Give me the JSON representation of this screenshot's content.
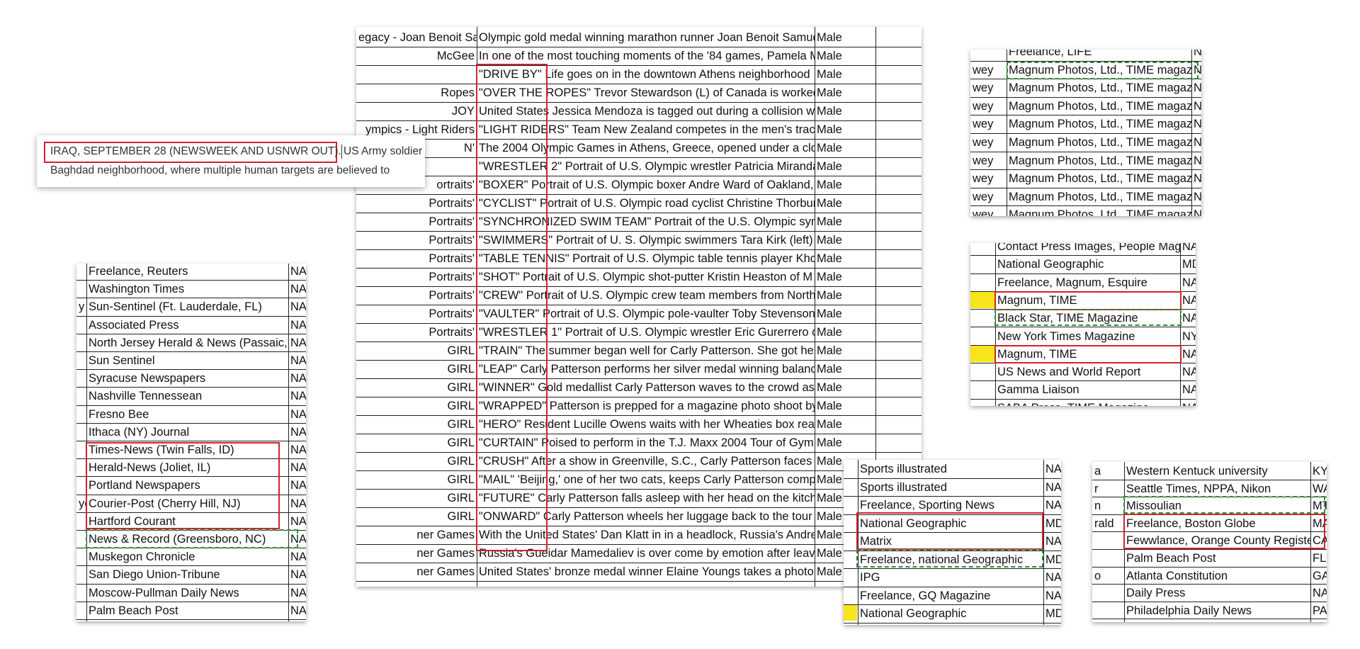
{
  "colors": {
    "highlight_red": "#d0242c",
    "highlight_green_dashed": "#2e8b3d",
    "marker_yellow": "#f6e51c",
    "grid": "#222222"
  },
  "center_table": {
    "rows": [
      [
        "egacy - Joan Benoit Sar",
        "Olympic gold medal winning marathon runner Joan Benoit Samue",
        "Male"
      ],
      [
        "McGee",
        "In one of the most touching moments of the '84 games, Pamela M",
        "Male"
      ],
      [
        "",
        "\"DRIVE BY\" Life goes on in the downtown Athens neighborhood",
        "Male"
      ],
      [
        "Ropes",
        "\"OVER THE ROPES\" Trevor Stewardson (L) of Canada is worked a",
        "Male"
      ],
      [
        "JOY",
        "United States Jessica Mendoza is tagged out during a collision wh",
        "Male"
      ],
      [
        "ympics - Light Riders",
        "\"LIGHT RIDERS\" Team New Zealand competes in the men's track",
        "Male"
      ],
      [
        "N'",
        "The 2004 Olympic Games in Athens, Greece, opened under a clou",
        "Male"
      ],
      [
        "",
        "\"WRESTLER 2\" Portrait of U.S. Olympic wrestler Patricia Miranda",
        "Male"
      ],
      [
        "ortraits'",
        "\"BOXER\" Portrait of U.S. Olympic boxer Andre Ward of Oakland,",
        "Male"
      ],
      [
        "Portraits'",
        "\"CYCLIST\" Portrait of U.S. Olympic road cyclist Christine Thorburn",
        "Male"
      ],
      [
        "Portraits'",
        "\"SYNCHRONIZED SWIM TEAM\" Portrait of the U.S. Olympic sync",
        "Male"
      ],
      [
        "Portraits'",
        "\"SWIMMERS\" Portrait of U. S. Olympic swimmers Tara Kirk (left)",
        "Male"
      ],
      [
        "Portraits'",
        "\"TABLE TENNIS\" Portrait of U.S. Olympic table tennis player Khoa",
        "Male"
      ],
      [
        "Portraits'",
        "\"SHOT\" Portrait of U.S. Olympic shot-putter Kristin Heaston of M",
        "Male"
      ],
      [
        "Portraits'",
        "\"CREW\" Portrait of U.S. Olympic crew team members from North",
        "Male"
      ],
      [
        "Portraits'",
        "\"VAULTER\" Portrait of U.S. Olympic pole-vaulter Toby Stevenson",
        "Male"
      ],
      [
        "Portraits'",
        "\"WRESTLER 1\" Portrait of U.S. Olympic wrestler Eric Gurerrero o",
        "Male"
      ],
      [
        "GIRL",
        "\"TRAIN\" The summer began well for Carly Patterson. She got her",
        "Male"
      ],
      [
        "GIRL",
        "\"LEAP\" Carly Patterson performs her silver medal winning balanc",
        "Male"
      ],
      [
        "GIRL",
        "\"WINNER\" Gold medallist Carly Patterson waves to the crowd as",
        "Male"
      ],
      [
        "GIRL",
        "\"WRAPPED\" Patterson is prepped for a magazine photo shoot by",
        "Male"
      ],
      [
        "GIRL",
        "\"HERO\" Resident Lucille Owens waits with her Wheaties box read",
        "Male"
      ],
      [
        "GIRL",
        "\"CURTAIN\" Poised to perform in the T.J. Maxx 2004 Tour of Gym",
        "Male"
      ],
      [
        "GIRL",
        "\"CRUSH\" After a show in Greenville, S.C., Carly Patterson faces a",
        "Male"
      ],
      [
        "GIRL",
        "\"MAIL\" 'Beijing,' one of her two cats, keeps Carly Patterson comp",
        "Male"
      ],
      [
        "GIRL",
        "\"FUTURE\" Carly Patterson falls asleep with her head on the kitch",
        "Male"
      ],
      [
        "GIRL",
        "\"ONWARD\" Carly Patterson wheels her luggage back to the tour",
        "Male"
      ],
      [
        "ner Games",
        "With the United States' Dan Klatt in in a headlock, Russia's Andre",
        "Male"
      ],
      [
        "ner Games",
        "Russia's Gueidar Mamedaliev is over come by emotion after leavi",
        "Male"
      ],
      [
        "ner Games",
        "United States' bronze medal winner Elaine Youngs takes a photo",
        "Male"
      ]
    ]
  },
  "popup": {
    "line1_boxed": "IRAQ, SEPTEMBER 28 (NEWSWEEK AND USNWR OUT).",
    "line1_rest": "US Army soldier",
    "line2": "Baghdad neighborhood, where multiple human targets are believed to"
  },
  "left_table": {
    "rows": [
      [
        "",
        "Freelance, Reuters",
        "NA"
      ],
      [
        "",
        "Washington Times",
        "NA"
      ],
      [
        "y",
        "Sun-Sentinel (Ft. Lauderdale, FL)",
        "NA"
      ],
      [
        "",
        "Associated Press",
        "NA"
      ],
      [
        "",
        "North Jersey Herald & News (Passaic, N",
        "NA"
      ],
      [
        "",
        "Sun Sentinel",
        "NA"
      ],
      [
        "",
        "Syracuse Newspapers",
        "NA"
      ],
      [
        "",
        "Nashville Tennessean",
        "NA"
      ],
      [
        "",
        "Fresno Bee",
        "NA"
      ],
      [
        "",
        "Ithaca (NY) Journal",
        "NA"
      ],
      [
        "",
        "Times-News (Twin Falls, ID)",
        "NA"
      ],
      [
        "",
        "Herald-News (Joliet, IL)",
        "NA"
      ],
      [
        "",
        "Portland Newspapers",
        "NA"
      ],
      [
        "ye",
        "Courier-Post (Cherry Hill, NJ)",
        "NA"
      ],
      [
        "",
        "Hartford Courant",
        "NA"
      ],
      [
        "",
        "News & Record (Greensboro, NC)",
        "NA"
      ],
      [
        "",
        "Muskegon Chronicle",
        "NA"
      ],
      [
        "",
        "San Diego Union-Tribune",
        "NA"
      ],
      [
        "",
        "Moscow-Pullman Daily News",
        "NA"
      ],
      [
        "",
        "Palm Beach Post",
        "NA"
      ]
    ]
  },
  "top_right_table": {
    "rows": [
      [
        "",
        "Freelance, LIFE",
        "NA"
      ],
      [
        "wey",
        "Magnum Photos, Ltd., TIME magazi",
        "NA"
      ],
      [
        "wey",
        "Magnum Photos, Ltd., TIME magazi",
        "NA"
      ],
      [
        "wey",
        "Magnum Photos, Ltd., TIME magazi",
        "NA"
      ],
      [
        "wey",
        "Magnum Photos, Ltd., TIME magazi",
        "NA"
      ],
      [
        "wey",
        "Magnum Photos, Ltd., TIME magazi",
        "NA"
      ],
      [
        "wey",
        "Magnum Photos, Ltd., TIME magazi",
        "NA"
      ],
      [
        "wey",
        "Magnum Photos, Ltd., TIME magazi",
        "NA"
      ],
      [
        "wey",
        "Magnum Photos, Ltd., TIME magazi",
        "NA"
      ],
      [
        "wey",
        "Magnum Photos, Ltd., TIME magazi",
        "NA"
      ]
    ]
  },
  "mid_right_table": {
    "rows": [
      [
        "",
        "Contact Press Images, People Maga",
        "NA"
      ],
      [
        "",
        "National Geographic",
        "MD"
      ],
      [
        "",
        "Freelance, Magnum, Esquire",
        "NA"
      ],
      [
        "",
        "Magnum, TIME",
        "NA"
      ],
      [
        "",
        "Black Star, TIME Magazine",
        "NA"
      ],
      [
        "",
        "New York Times Magazine",
        "NY"
      ],
      [
        "",
        "Magnum, TIME",
        "NA"
      ],
      [
        "",
        "US News and World Report",
        "NA"
      ],
      [
        "",
        "Gamma Liaison",
        "NA"
      ],
      [
        "",
        "SABA Press, TIME Magazine",
        "NA"
      ]
    ]
  },
  "bottom_mid_table": {
    "rows": [
      [
        "Sports illustrated",
        "NA"
      ],
      [
        "Sports illustrated",
        "NA"
      ],
      [
        "Freelance, Sporting News",
        "NA"
      ],
      [
        "National Geographic",
        "MD"
      ],
      [
        "Matrix",
        "NA"
      ],
      [
        "Freelance, national Geographic",
        "MD"
      ],
      [
        "IPG",
        "NA"
      ],
      [
        "Freelance, GQ Magazine",
        "NA"
      ],
      [
        "National Geographic",
        "MD"
      ]
    ]
  },
  "bottom_right_table": {
    "rows": [
      [
        "a",
        "Western Kentuck university",
        "KY"
      ],
      [
        "r",
        "Seattle Times, NPPA, Nikon",
        "WA"
      ],
      [
        "n",
        "Missoulian",
        "MT"
      ],
      [
        "rald",
        "Freelance, Boston Globe",
        "MA"
      ],
      [
        "",
        "Fewwlance, Orange County Register",
        "CA"
      ],
      [
        "",
        "Palm Beach Post",
        "FL"
      ],
      [
        "o",
        "Atlanta Constitution",
        "GA"
      ],
      [
        "",
        "Daily Press",
        "NA"
      ],
      [
        "",
        "Philadelphia Daily News",
        "PA"
      ]
    ]
  }
}
